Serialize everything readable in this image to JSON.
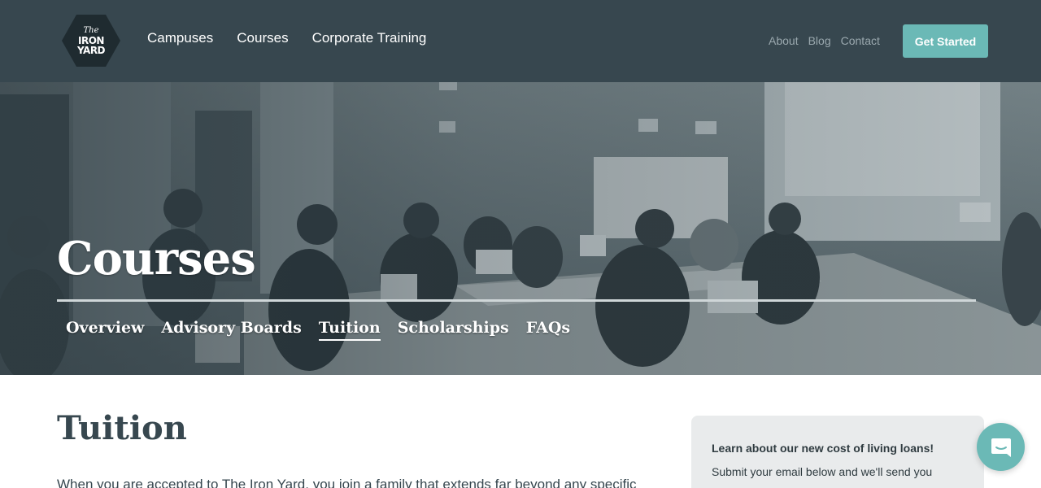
{
  "brand": {
    "logo_line1": "The",
    "logo_line2": "IRON",
    "logo_line3": "YARD"
  },
  "header": {
    "primary_nav": [
      {
        "label": "Campuses"
      },
      {
        "label": "Courses"
      },
      {
        "label": "Corporate Training"
      }
    ],
    "secondary_nav": [
      {
        "label": "About"
      },
      {
        "label": "Blog"
      },
      {
        "label": "Contact"
      }
    ],
    "cta_label": "Get Started"
  },
  "hero": {
    "title": "Courses",
    "sub_nav": [
      {
        "label": "Overview",
        "active": false
      },
      {
        "label": "Advisory Boards",
        "active": false
      },
      {
        "label": "Tuition",
        "active": true
      },
      {
        "label": "Scholarships",
        "active": false
      },
      {
        "label": "FAQs",
        "active": false
      }
    ]
  },
  "main": {
    "heading": "Tuition",
    "intro": "When you are accepted to The Iron Yard, you join a family that extends far beyond any specific"
  },
  "sidebar": {
    "card_title": "Learn about our new cost of living loans!",
    "card_body": "Submit your email below and we'll send you"
  },
  "colors": {
    "header_bg": "#37474f",
    "accent": "#6bb9b6",
    "text_dark": "#37474f"
  },
  "icons": {
    "logo": "iron-yard-hexagon-logo",
    "chat": "chat-bubble-icon"
  }
}
